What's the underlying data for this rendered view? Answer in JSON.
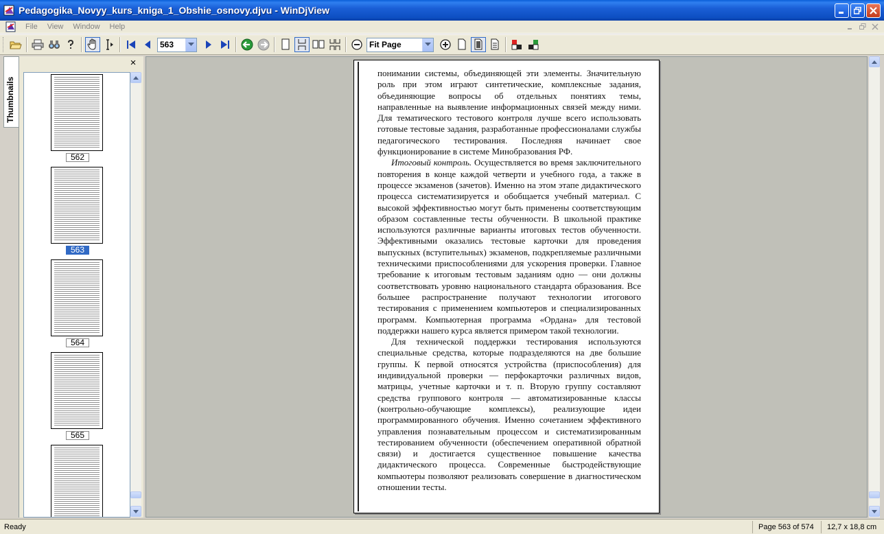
{
  "window": {
    "title": "Pedagogika_Novyy_kurs_kniga_1_Obshie_osnovy.djvu - WinDjView"
  },
  "menu": {
    "items": [
      "File",
      "View",
      "Window",
      "Help"
    ]
  },
  "toolbar": {
    "page_number": "563",
    "zoom": "Fit Page"
  },
  "sidebar": {
    "tab_label": "Thumbnails",
    "close_glyph": "×",
    "thumbnails": [
      {
        "label": "562",
        "selected": false
      },
      {
        "label": "563",
        "selected": true
      },
      {
        "label": "564",
        "selected": false
      },
      {
        "label": "565",
        "selected": false
      }
    ]
  },
  "document": {
    "paragraphs": [
      "понимании системы, объединяющей эти элементы. Значительную роль при этом играют синтетические, комплексные задания, объединяющие вопросы об отдельных понятиях темы, направленные на выявление информационных связей между ними. Для тематического тестового контроля лучше всего использовать готовые тестовые задания, разработанные профессионалами службы педагогического тестирования. Последняя начинает свое функционирование в системе Минобразования РФ.",
      "Для технической поддержки тестирования используются специальные средства, которые подразделяются на две большие группы. К первой относятся устройства (приспособления) для индивидуальной проверки — перфокарточки различных видов, матрицы, учетные карточки и т. п. Вторую группу составляют средства группового контроля — автоматизированные классы (контрольно-обучающие комплексы), реализующие идеи программированного обучения. Именно сочетанием эффективного управления познавательным процессом и систематизированным тестированием обученности (обеспечением оперативной обратной связи) и достигается существенное повышение качества дидактического процесса. Современные быстродействующие компьютеры позволяют реализовать совершение в диагностическом отношении тесты."
    ],
    "final_control": {
      "term": "Итоговый контроль.",
      "text": " Осуществляется во время заключительного повторения в конце каждой четверти и учебного года, а также в процессе экзаменов (зачетов). Именно на этом этапе дидактического процесса систематизируется и обобщается учебный материал. С высокой эффективностью могут быть применены соответствующим образом составленные тесты обученности. В школьной практике используются различные варианты итоговых тестов обученности. Эффективными оказались тестовые карточки для проведения выпускных (вступительных) экзаменов, подкрепляемые различными техническими приспособлениями для ускорения проверки. Главное требование к итоговым тестовым заданиям одно — они должны соответствовать уровню национального стандарта образования. Все большее распространение получают технологии итогового тестирования с применением компьютеров и специализированных программ. Компьютерная программа «Ордана» для тестовой поддержки нашего курса является примером такой технологии."
    }
  },
  "status": {
    "ready": "Ready",
    "page_info": "Page 563 of 574",
    "page_size": "12,7 x 18,8 cm"
  },
  "colors": {
    "titlebar": "#0d4fc2",
    "selection": "#316ac5",
    "workspace": "#c0c0b8"
  }
}
